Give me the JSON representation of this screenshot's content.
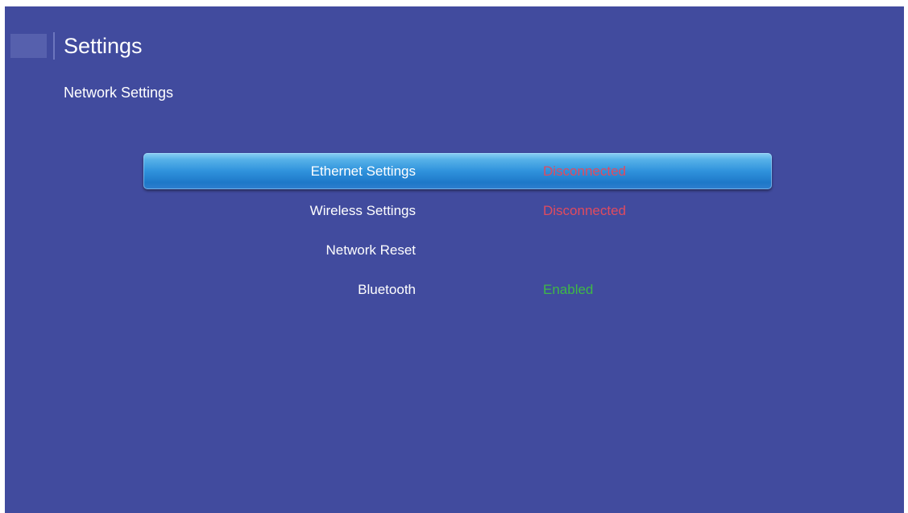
{
  "header": {
    "title": "Settings",
    "subtitle": "Network Settings"
  },
  "menu": {
    "items": [
      {
        "label": "Ethernet Settings",
        "status": "Disconnected",
        "status_color": "#e04b5f",
        "selected": true
      },
      {
        "label": "Wireless Settings",
        "status": "Disconnected",
        "status_color": "#e04b5f",
        "selected": false
      },
      {
        "label": "Network Reset",
        "status": "",
        "status_color": "",
        "selected": false
      },
      {
        "label": "Bluetooth",
        "status": "Enabled",
        "status_color": "#3fb846",
        "selected": false
      }
    ]
  },
  "colors": {
    "background": "#414b9e",
    "highlight": "#2f92dc",
    "text": "#ffffff"
  },
  "icons": {
    "app": "settings-app-icon"
  }
}
